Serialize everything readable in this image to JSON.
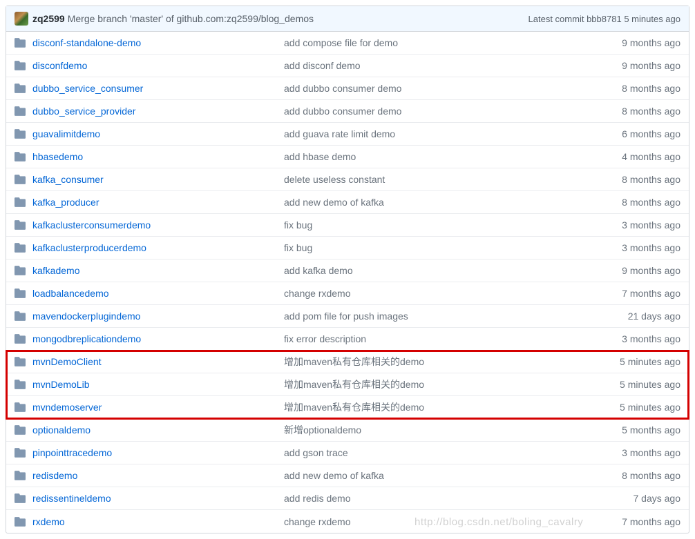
{
  "commit": {
    "author": "zq2599",
    "message": "Merge branch 'master' of github.com:zq2599/blog_demos",
    "latest_label": "Latest commit",
    "sha": "bbb8781",
    "age": "5 minutes ago"
  },
  "files": [
    {
      "name": "disconf-standalone-demo",
      "msg": "add compose file for demo",
      "age": "9 months ago"
    },
    {
      "name": "disconfdemo",
      "msg": "add disconf demo",
      "age": "9 months ago"
    },
    {
      "name": "dubbo_service_consumer",
      "msg": "add dubbo consumer demo",
      "age": "8 months ago"
    },
    {
      "name": "dubbo_service_provider",
      "msg": "add dubbo consumer demo",
      "age": "8 months ago"
    },
    {
      "name": "guavalimitdemo",
      "msg": "add guava rate limit demo",
      "age": "6 months ago"
    },
    {
      "name": "hbasedemo",
      "msg": "add hbase demo",
      "age": "4 months ago"
    },
    {
      "name": "kafka_consumer",
      "msg": "delete useless constant",
      "age": "8 months ago"
    },
    {
      "name": "kafka_producer",
      "msg": "add new demo of kafka",
      "age": "8 months ago"
    },
    {
      "name": "kafkaclusterconsumerdemo",
      "msg": "fix bug",
      "age": "3 months ago"
    },
    {
      "name": "kafkaclusterproducerdemo",
      "msg": "fix bug",
      "age": "3 months ago"
    },
    {
      "name": "kafkademo",
      "msg": "add kafka demo",
      "age": "9 months ago"
    },
    {
      "name": "loadbalancedemo",
      "msg": "change rxdemo",
      "age": "7 months ago"
    },
    {
      "name": "mavendockerplugindemo",
      "msg": "add pom file for push images",
      "age": "21 days ago"
    },
    {
      "name": "mongodbreplicationdemo",
      "msg": "fix error description",
      "age": "3 months ago"
    },
    {
      "name": "mvnDemoClient",
      "msg": "增加maven私有仓库相关的demo",
      "age": "5 minutes ago"
    },
    {
      "name": "mvnDemoLib",
      "msg": "增加maven私有仓库相关的demo",
      "age": "5 minutes ago"
    },
    {
      "name": "mvndemoserver",
      "msg": "增加maven私有仓库相关的demo",
      "age": "5 minutes ago"
    },
    {
      "name": "optionaldemo",
      "msg": "新增optionaldemo",
      "age": "5 months ago"
    },
    {
      "name": "pinpointtracedemo",
      "msg": "add gson trace",
      "age": "3 months ago"
    },
    {
      "name": "redisdemo",
      "msg": "add new demo of kafka",
      "age": "8 months ago"
    },
    {
      "name": "redissentineldemo",
      "msg": "add redis demo",
      "age": "7 days ago"
    },
    {
      "name": "rxdemo",
      "msg": "change rxdemo",
      "age": "7 months ago"
    }
  ],
  "highlight": {
    "start_index": 14,
    "end_index": 16
  },
  "watermark": "http://blog.csdn.net/boling_cavalry"
}
